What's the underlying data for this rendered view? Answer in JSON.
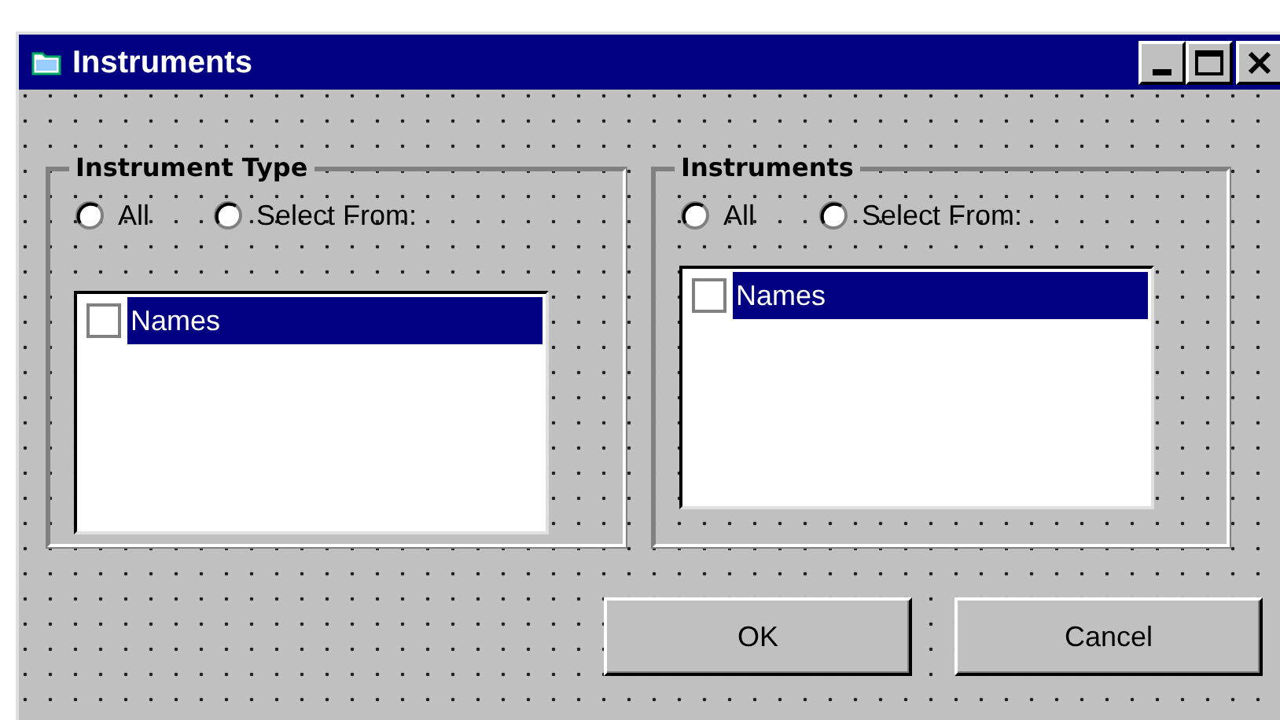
{
  "window": {
    "title": "Instruments"
  },
  "groups": [
    {
      "title": "Instrument Type",
      "radios": [
        {
          "label": "All",
          "selected": false
        },
        {
          "label": "Select From:",
          "selected": false
        }
      ],
      "list": {
        "items": [
          {
            "label": "Names",
            "checked": false,
            "selected": true
          }
        ]
      }
    },
    {
      "title": "Instruments",
      "radios": [
        {
          "label": "All",
          "selected": false
        },
        {
          "label": "Select From:",
          "selected": false
        }
      ],
      "list": {
        "items": [
          {
            "label": "Names",
            "checked": false,
            "selected": true
          }
        ]
      }
    }
  ],
  "buttons": [
    {
      "label": "OK"
    },
    {
      "label": "Cancel"
    }
  ]
}
